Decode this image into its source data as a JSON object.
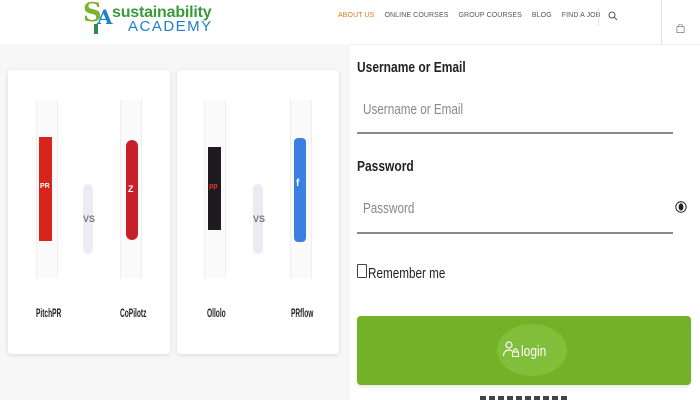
{
  "header": {
    "logo": {
      "mark": "SA",
      "line1": "sustainability",
      "line2": "ACADEMY"
    },
    "nav": [
      {
        "label": "ABOUT US",
        "active": true
      },
      {
        "label": "ONLINE COURSES",
        "active": false
      },
      {
        "label": "GROUP COURSES",
        "active": false
      },
      {
        "label": "BLOG",
        "active": false
      },
      {
        "label": "FIND A JOB",
        "active": false
      }
    ],
    "icons": [
      "search-icon",
      "bag-icon"
    ],
    "accent_color": "#e07b1f"
  },
  "comparisons": [
    {
      "left": {
        "name": "PitchPR",
        "color": "#d9241b"
      },
      "vs": "VS",
      "right": {
        "name": "CoPilotz",
        "color": "#c8202a"
      }
    },
    {
      "left": {
        "name": "Ollolo",
        "color": "#1e1a1e"
      },
      "vs": "VS",
      "right": {
        "name": "PRflow",
        "color": "#3b7fe0"
      }
    }
  ],
  "login": {
    "username_label": "Username or Email",
    "username_placeholder": "Username or Email",
    "password_label": "Password",
    "password_placeholder": "Password",
    "remember_label": "Remember me",
    "button_label": "login",
    "button_color": "#72b128"
  }
}
